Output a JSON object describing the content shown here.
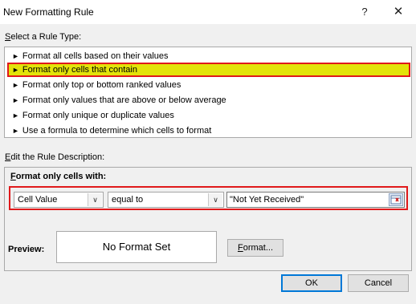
{
  "dialog": {
    "title": "New Formatting Rule",
    "help_glyph": "?",
    "close_glyph": "✕"
  },
  "rule_type": {
    "label_first": "S",
    "label_rest": "elect a Rule Type:",
    "items": [
      {
        "label": "Format all cells based on their values"
      },
      {
        "label": "Format only cells that contain",
        "selected": true
      },
      {
        "label": "Format only top or bottom ranked values"
      },
      {
        "label": "Format only values that are above or below average"
      },
      {
        "label": "Format only unique or duplicate values"
      },
      {
        "label": "Use a formula to determine which cells to format"
      }
    ]
  },
  "description": {
    "label_first": "E",
    "label_rest": "dit the Rule Description:",
    "heading_first": "F",
    "heading_rest": "ormat only cells with:",
    "condition_type": "Cell Value",
    "operator": "equal to",
    "value": "\"Not Yet Received\""
  },
  "preview": {
    "label": "Preview:",
    "text": "No Format Set"
  },
  "buttons": {
    "format_first": "F",
    "format_rest": "ormat...",
    "ok": "OK",
    "cancel": "Cancel"
  },
  "colors": {
    "selected_fill": "#e3e30a",
    "highlight_border": "#e0191b",
    "ok_border": "#0078d7"
  }
}
